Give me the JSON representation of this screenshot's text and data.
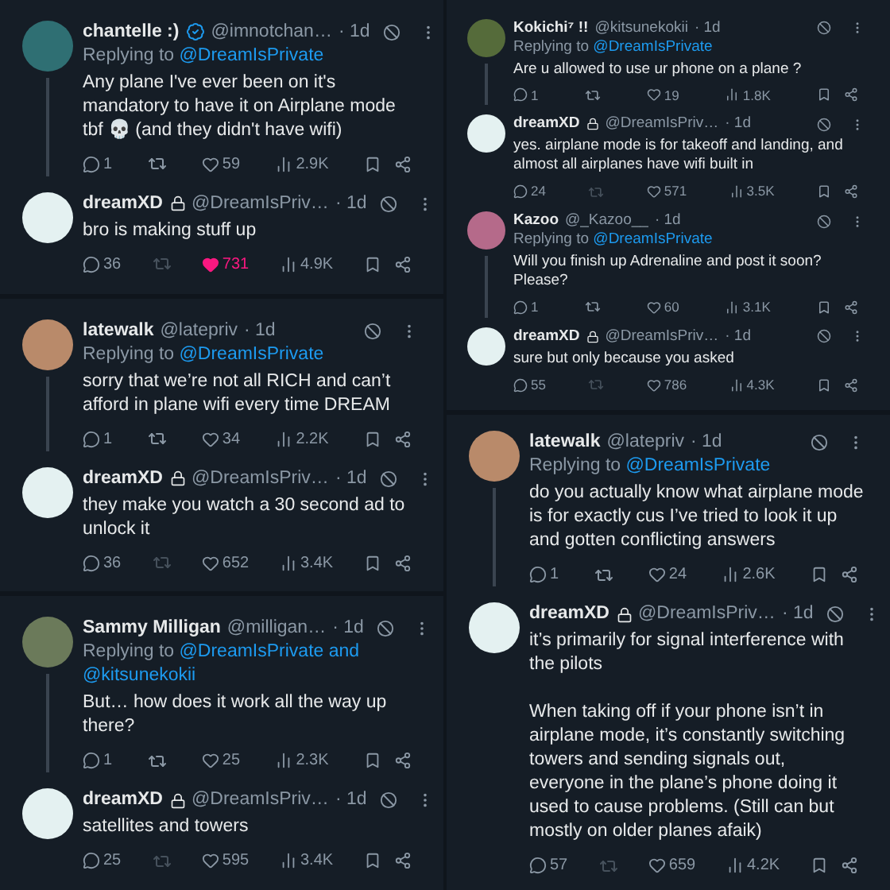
{
  "columns": [
    {
      "panels": [
        {
          "kind": "regular",
          "tweets": [
            {
              "name": "chantelle :)",
              "verified": true,
              "locked": false,
              "handle": "@imnotchan…",
              "time": "· 1d",
              "color": "#2f6f73",
              "reply_label": "Replying to",
              "replying_to": "@DreamIsPrivate",
              "text": "Any plane I've ever been on it's mandatory to have it on Airplane mode tbf 💀 (and they didn't have wifi)",
              "replies": "1",
              "retweet_enabled": true,
              "likes": "59",
              "liked": false,
              "views": "2.9K"
            },
            {
              "name": "dreamXD",
              "verified": false,
              "locked": true,
              "handle": "@DreamIsPriv…",
              "time": "· 1d",
              "color": "#e4f1f1",
              "text": "bro is making stuff up",
              "replies": "36",
              "retweet_enabled": false,
              "likes": "731",
              "liked": true,
              "views": "4.9K"
            }
          ]
        },
        {
          "kind": "regular",
          "tweets": [
            {
              "name": "latewalk",
              "verified": false,
              "locked": false,
              "handle": "@latepriv",
              "time": "· 1d",
              "color": "#b98a6a",
              "reply_label": "Replying to",
              "replying_to": "@DreamIsPrivate",
              "text": "sorry that we’re not all RICH and can’t afford in plane wifi every time DREAM",
              "replies": "1",
              "retweet_enabled": true,
              "likes": "34",
              "liked": false,
              "views": "2.2K"
            },
            {
              "name": "dreamXD",
              "verified": false,
              "locked": true,
              "handle": "@DreamIsPriv…",
              "time": "· 1d",
              "color": "#e4f1f1",
              "text": "they make you watch a 30 second ad to unlock it",
              "replies": "36",
              "retweet_enabled": false,
              "likes": "652",
              "liked": false,
              "views": "3.4K"
            }
          ]
        },
        {
          "kind": "regular",
          "tweets": [
            {
              "name": "Sammy Milligan",
              "verified": false,
              "locked": false,
              "handle": "@milligan…",
              "time": "· 1d",
              "color": "#6b7a5a",
              "reply_label": "Replying to",
              "replying_to": "@DreamIsPrivate and @kitsunekokii",
              "text": "But… how does it work all the way up there?",
              "replies": "1",
              "retweet_enabled": true,
              "likes": "25",
              "liked": false,
              "views": "2.3K"
            },
            {
              "name": "dreamXD",
              "verified": false,
              "locked": true,
              "handle": "@DreamIsPriv…",
              "time": "· 1d",
              "color": "#e4f1f1",
              "text": "satellites and towers",
              "replies": "25",
              "retweet_enabled": false,
              "likes": "595",
              "liked": false,
              "views": "3.4K"
            }
          ]
        }
      ]
    },
    {
      "panels": [
        {
          "kind": "compact",
          "tweets": [
            {
              "name": "Kokichi⁷ !!",
              "verified": false,
              "locked": false,
              "handle": "@kitsunekokii",
              "time": "· 1d",
              "color": "#556b3a",
              "reply_label": "Replying to",
              "replying_to": "@DreamIsPrivate",
              "text": "Are u allowed to use ur phone on a plane ?",
              "replies": "1",
              "retweet_enabled": true,
              "likes": "19",
              "liked": false,
              "views": "1.8K"
            },
            {
              "name": "dreamXD",
              "verified": false,
              "locked": true,
              "handle": "@DreamIsPriv…",
              "time": "· 1d",
              "color": "#e4f1f1",
              "text": "yes. airplane mode is for takeoff and landing, and almost all airplanes have wifi built in",
              "replies": "24",
              "retweet_enabled": false,
              "likes": "571",
              "liked": false,
              "views": "3.5K"
            },
            {
              "name": "Kazoo",
              "verified": false,
              "locked": false,
              "handle": "@_Kazoo__",
              "time": "· 1d",
              "color": "#b56a8a",
              "reply_label": "Replying to",
              "replying_to": "@DreamIsPrivate",
              "text": "Will you finish up Adrenaline and post it soon? Please?",
              "replies": "1",
              "retweet_enabled": true,
              "likes": "60",
              "liked": false,
              "views": "3.1K"
            },
            {
              "name": "dreamXD",
              "verified": false,
              "locked": true,
              "handle": "@DreamIsPriv…",
              "time": "· 1d",
              "color": "#e4f1f1",
              "text": "sure but only because you asked",
              "replies": "55",
              "retweet_enabled": false,
              "likes": "786",
              "liked": false,
              "views": "4.3K"
            }
          ]
        },
        {
          "kind": "regular",
          "tweets": [
            {
              "name": "latewalk",
              "verified": false,
              "locked": false,
              "handle": "@latepriv",
              "time": "· 1d",
              "color": "#b98a6a",
              "reply_label": "Replying to",
              "replying_to": "@DreamIsPrivate",
              "text": "do you actually know what airplane mode is for exactly cus I’ve tried to look it up and gotten conflicting answers",
              "replies": "1",
              "retweet_enabled": true,
              "likes": "24",
              "liked": false,
              "views": "2.6K"
            },
            {
              "name": "dreamXD",
              "verified": false,
              "locked": true,
              "handle": "@DreamIsPriv…",
              "time": "· 1d",
              "color": "#e4f1f1",
              "text": "it’s primarily for signal interference with the pilots\n\nWhen taking off if your phone isn’t in airplane mode, it’s constantly switching towers and sending signals out, everyone in the plane’s phone doing it used to cause problems. (Still can but mostly on older planes afaik)",
              "replies": "57",
              "retweet_enabled": false,
              "likes": "659",
              "liked": false,
              "views": "4.2K"
            }
          ]
        }
      ]
    }
  ]
}
